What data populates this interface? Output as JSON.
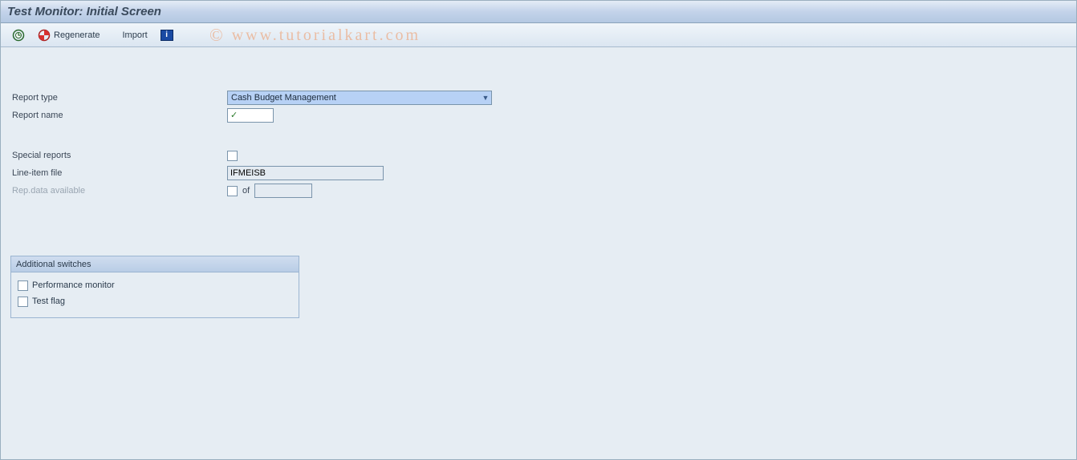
{
  "header": {
    "title": "Test Monitor: Initial Screen"
  },
  "toolbar": {
    "regenerate_label": "Regenerate",
    "import_label": "Import"
  },
  "watermark": {
    "symbol": "©",
    "text": "www.tutorialkart.com"
  },
  "form": {
    "report_type": {
      "label": "Report type",
      "value": "Cash Budget Management"
    },
    "report_name": {
      "label": "Report name",
      "value": ""
    },
    "special_reports": {
      "label": "Special reports"
    },
    "line_item_file": {
      "label": "Line-item file",
      "value": "IFMEISB"
    },
    "rep_data": {
      "label": "Rep.data available",
      "of_label": "of",
      "value": ""
    }
  },
  "group": {
    "title": "Additional switches",
    "perf_monitor": {
      "label": "Performance monitor"
    },
    "test_flag": {
      "label": "Test flag"
    }
  }
}
